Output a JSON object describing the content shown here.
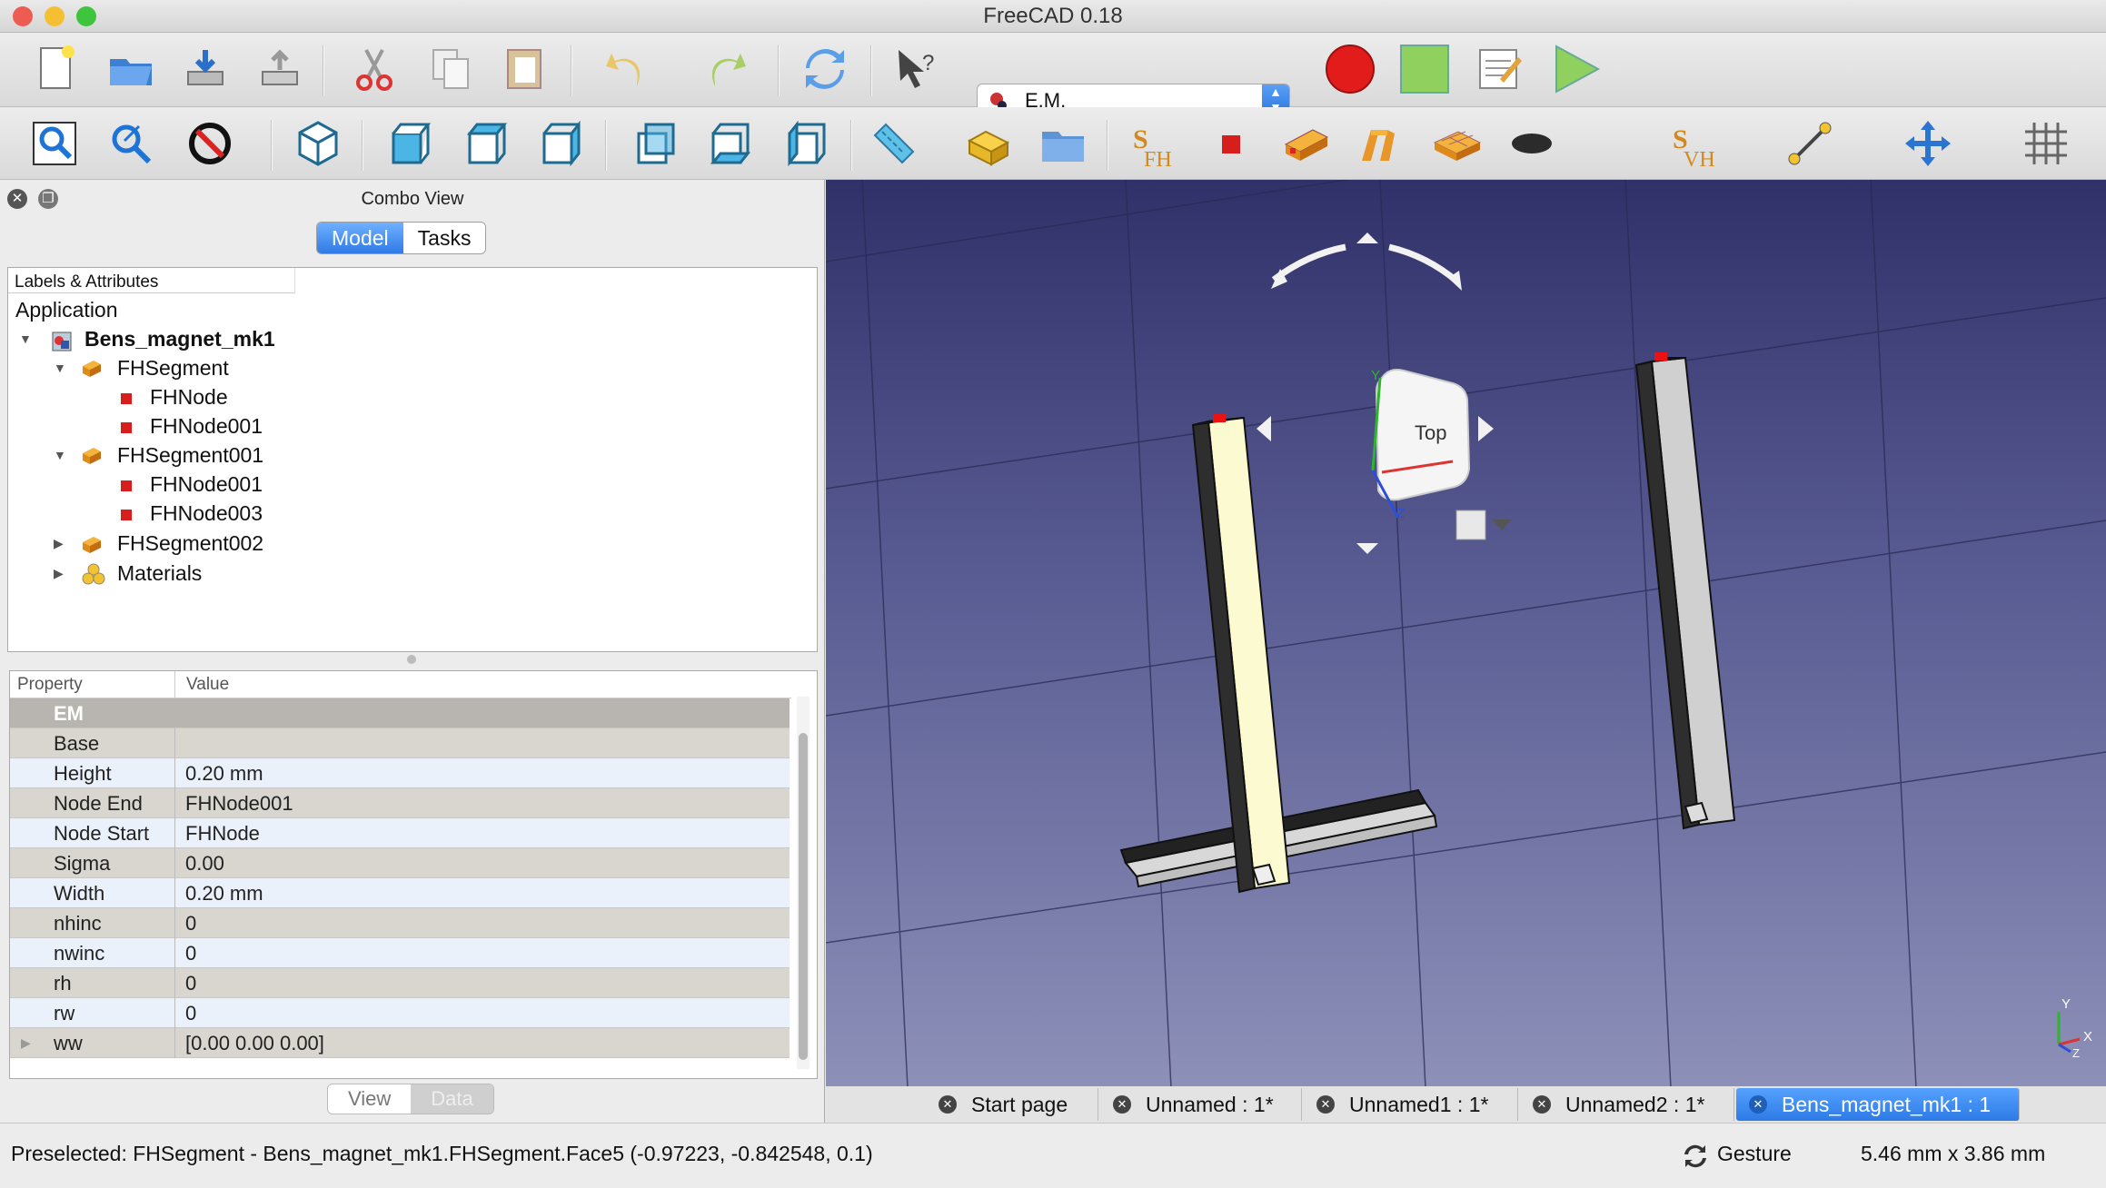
{
  "window": {
    "title": "FreeCAD 0.18",
    "traffic_lights": [
      "#ee5b52",
      "#f4bf33",
      "#3fc43e"
    ]
  },
  "toolbar": {
    "workbench": "E.M."
  },
  "combo_view": {
    "title": "Combo View",
    "tabs": {
      "model": "Model",
      "tasks": "Tasks"
    },
    "tree_header": "Labels & Attributes",
    "tree": {
      "application": "Application",
      "document": "Bens_magnet_mk1",
      "items": [
        {
          "label": "FHSegment"
        },
        {
          "label": "FHNode"
        },
        {
          "label": "FHNode001"
        },
        {
          "label": "FHSegment001"
        },
        {
          "label": "FHNode001"
        },
        {
          "label": "FHNode003"
        },
        {
          "label": "FHSegment002"
        },
        {
          "label": "Materials"
        }
      ]
    },
    "property_header": {
      "property": "Property",
      "value": "Value"
    },
    "group": "EM",
    "properties": [
      {
        "key": "Base",
        "value": ""
      },
      {
        "key": "Height",
        "value": "0.20 mm"
      },
      {
        "key": "Node End",
        "value": "FHNode001"
      },
      {
        "key": "Node Start",
        "value": "FHNode"
      },
      {
        "key": "Sigma",
        "value": "0.00"
      },
      {
        "key": "Width",
        "value": "0.20 mm"
      },
      {
        "key": "nhinc",
        "value": "0"
      },
      {
        "key": "nwinc",
        "value": "0"
      },
      {
        "key": "rh",
        "value": "0"
      },
      {
        "key": "rw",
        "value": "0"
      },
      {
        "key": "ww",
        "value": "[0.00 0.00 0.00]"
      }
    ],
    "bottom_tabs": {
      "view": "View",
      "data": "Data"
    }
  },
  "viewport": {
    "navcube_face": "Top",
    "axis_x": "X",
    "axis_y": "Y",
    "axis_z": "Z"
  },
  "doc_tabs": [
    {
      "label": "Start page",
      "active": false
    },
    {
      "label": "Unnamed : 1*",
      "active": false
    },
    {
      "label": "Unnamed1 : 1*",
      "active": false
    },
    {
      "label": "Unnamed2 : 1*",
      "active": false
    },
    {
      "label": "Bens_magnet_mk1 : 1",
      "active": true
    }
  ],
  "status": {
    "preselection": "Preselected: FHSegment - Bens_magnet_mk1.FHSegment.Face5 (-0.97223, -0.842548, 0.1)",
    "navigation_style": "Gesture",
    "dimensions": "5.46 mm x 3.86 mm"
  }
}
